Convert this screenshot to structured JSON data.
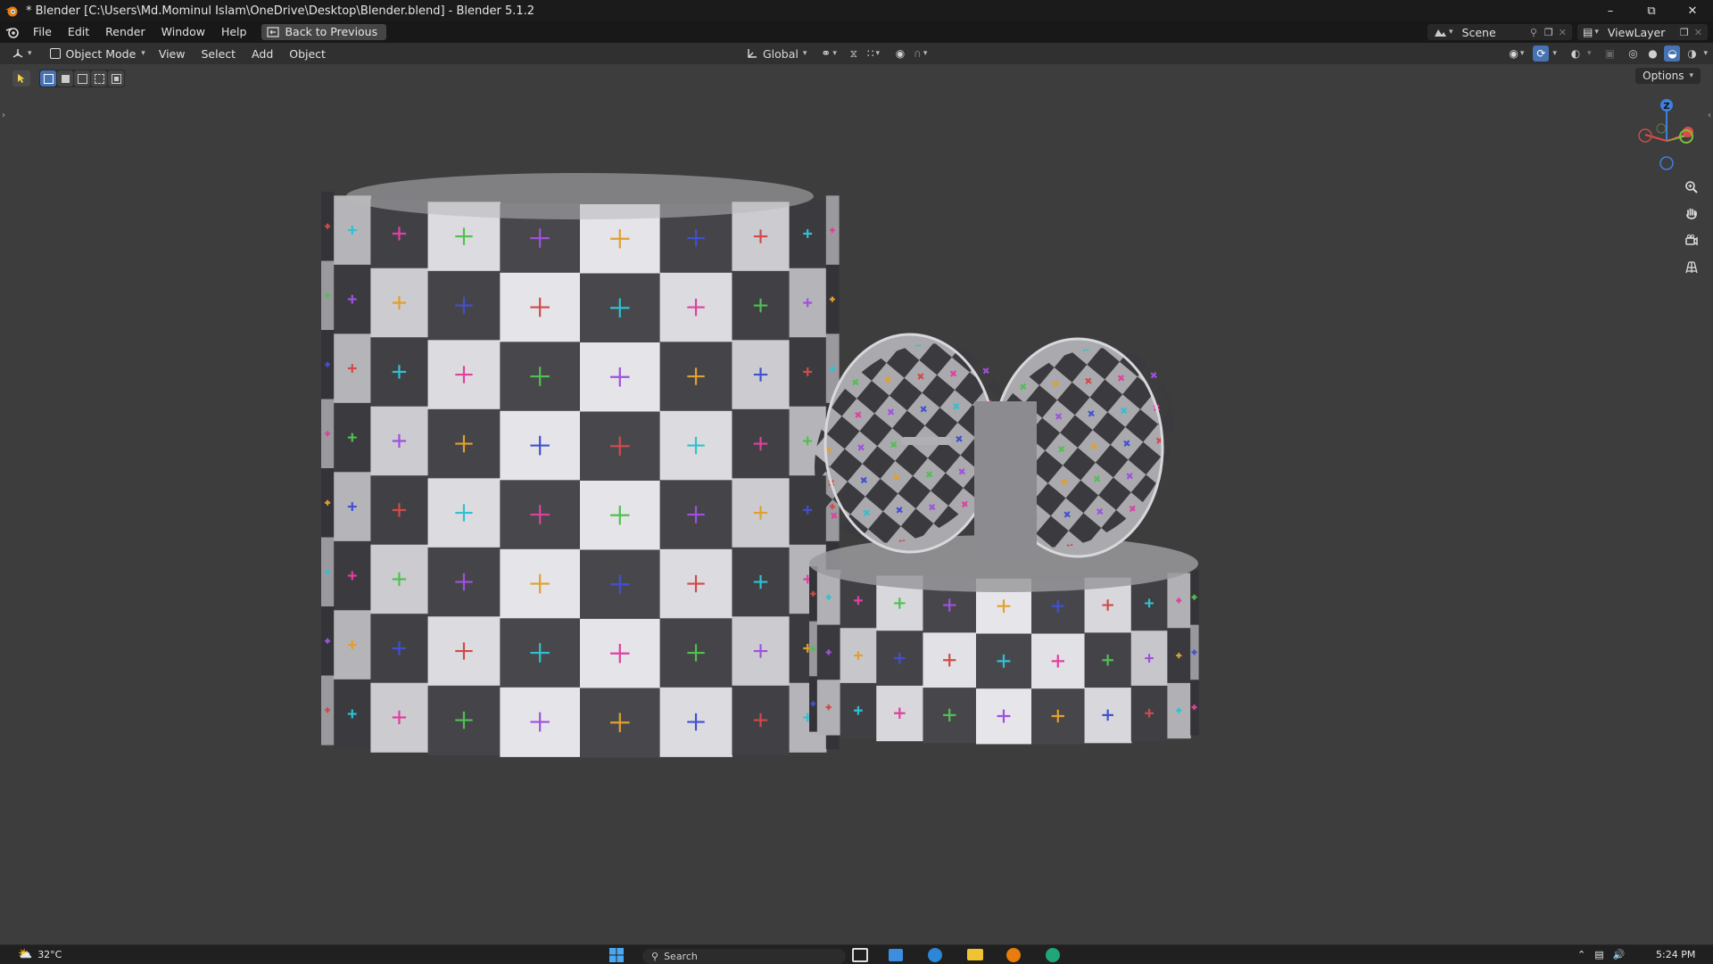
{
  "window": {
    "title": "* Blender [C:\\Users\\Md.Mominul Islam\\OneDrive\\Desktop\\Blender.blend] - Blender 5.1.2",
    "controls": {
      "minimize": "–",
      "restore": "⧉",
      "close": "✕"
    }
  },
  "topbar": {
    "menus": [
      "File",
      "Edit",
      "Render",
      "Window",
      "Help"
    ],
    "back_button": "Back to Previous",
    "scene_label": "Scene",
    "viewlayer_label": "ViewLayer"
  },
  "header3d": {
    "mode": "Object Mode",
    "menus": [
      "View",
      "Select",
      "Add",
      "Object"
    ],
    "transform_orientation": "Global"
  },
  "viewport": {
    "options_label": "Options",
    "gizmo_axes": {
      "z": "Z"
    },
    "shading_mode": "solid"
  },
  "taskbar": {
    "weather_temp": "32°C",
    "search_placeholder": "Search",
    "clock_time": "5:24 PM"
  },
  "colors": {
    "accent": "#4772b3",
    "axis_x": "#e04a4a",
    "axis_y": "#7fbf3f",
    "axis_z": "#3f7fdf"
  }
}
